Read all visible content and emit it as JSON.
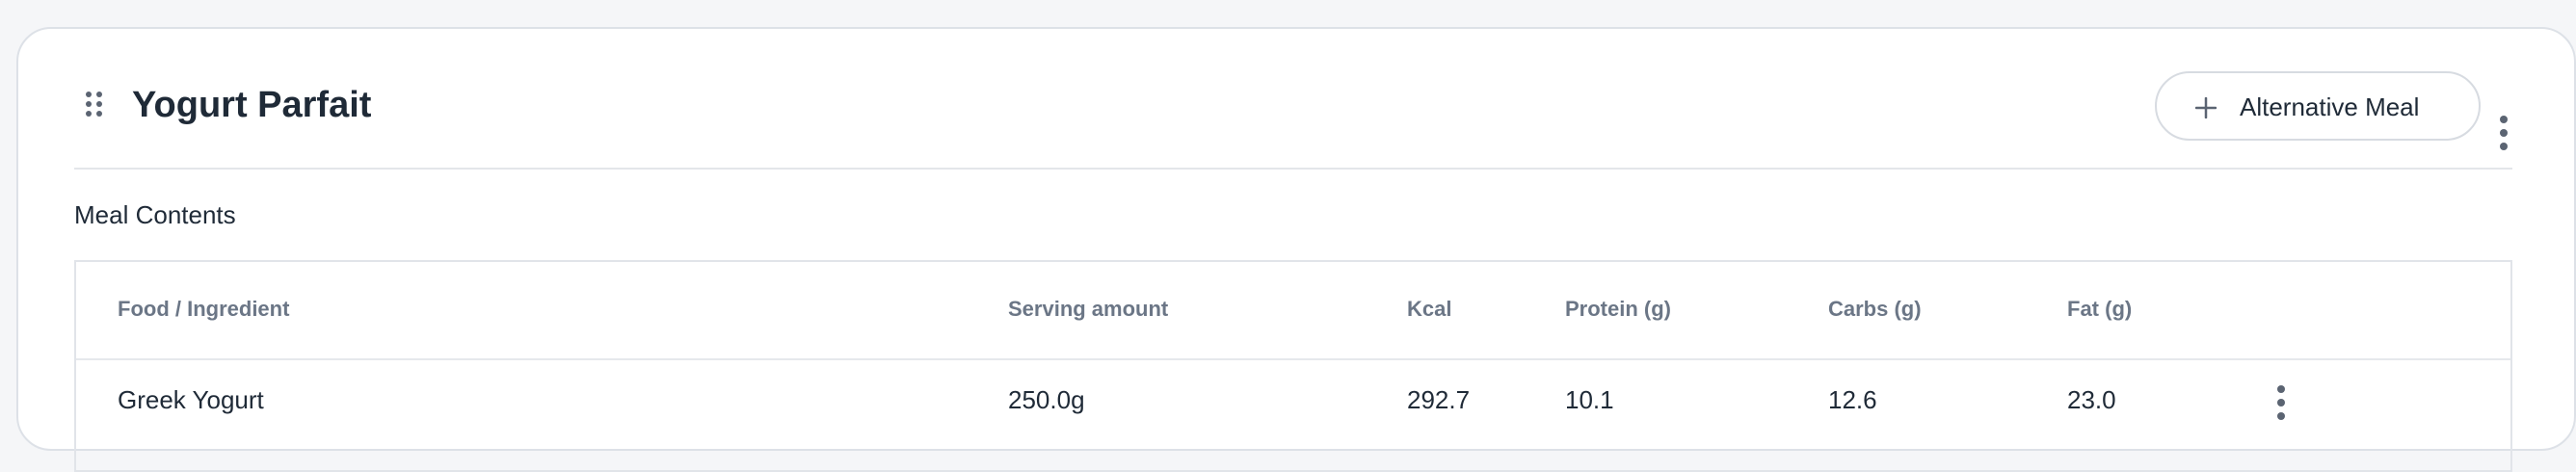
{
  "meal": {
    "title": "Yogurt Parfait",
    "alternative_button_label": "Alternative Meal",
    "section_label": "Meal Contents"
  },
  "icons": {
    "drag": "drag-handle-icon",
    "plus": "plus-icon",
    "more": "more-vertical-icon"
  },
  "table": {
    "headers": {
      "food": "Food / Ingredient",
      "serving": "Serving amount",
      "kcal": "Kcal",
      "protein": "Protein (g)",
      "carbs": "Carbs (g)",
      "fat": "Fat (g)"
    },
    "rows": [
      {
        "food": "Greek Yogurt",
        "serving": "250.0g",
        "kcal": "292.7",
        "protein": "10.1",
        "carbs": "12.6",
        "fat": "23.0"
      }
    ]
  },
  "colors": {
    "text_primary": "#1f2a37",
    "text_muted": "#6b7686",
    "border": "#dde1e7",
    "icon": "#5b6472"
  }
}
